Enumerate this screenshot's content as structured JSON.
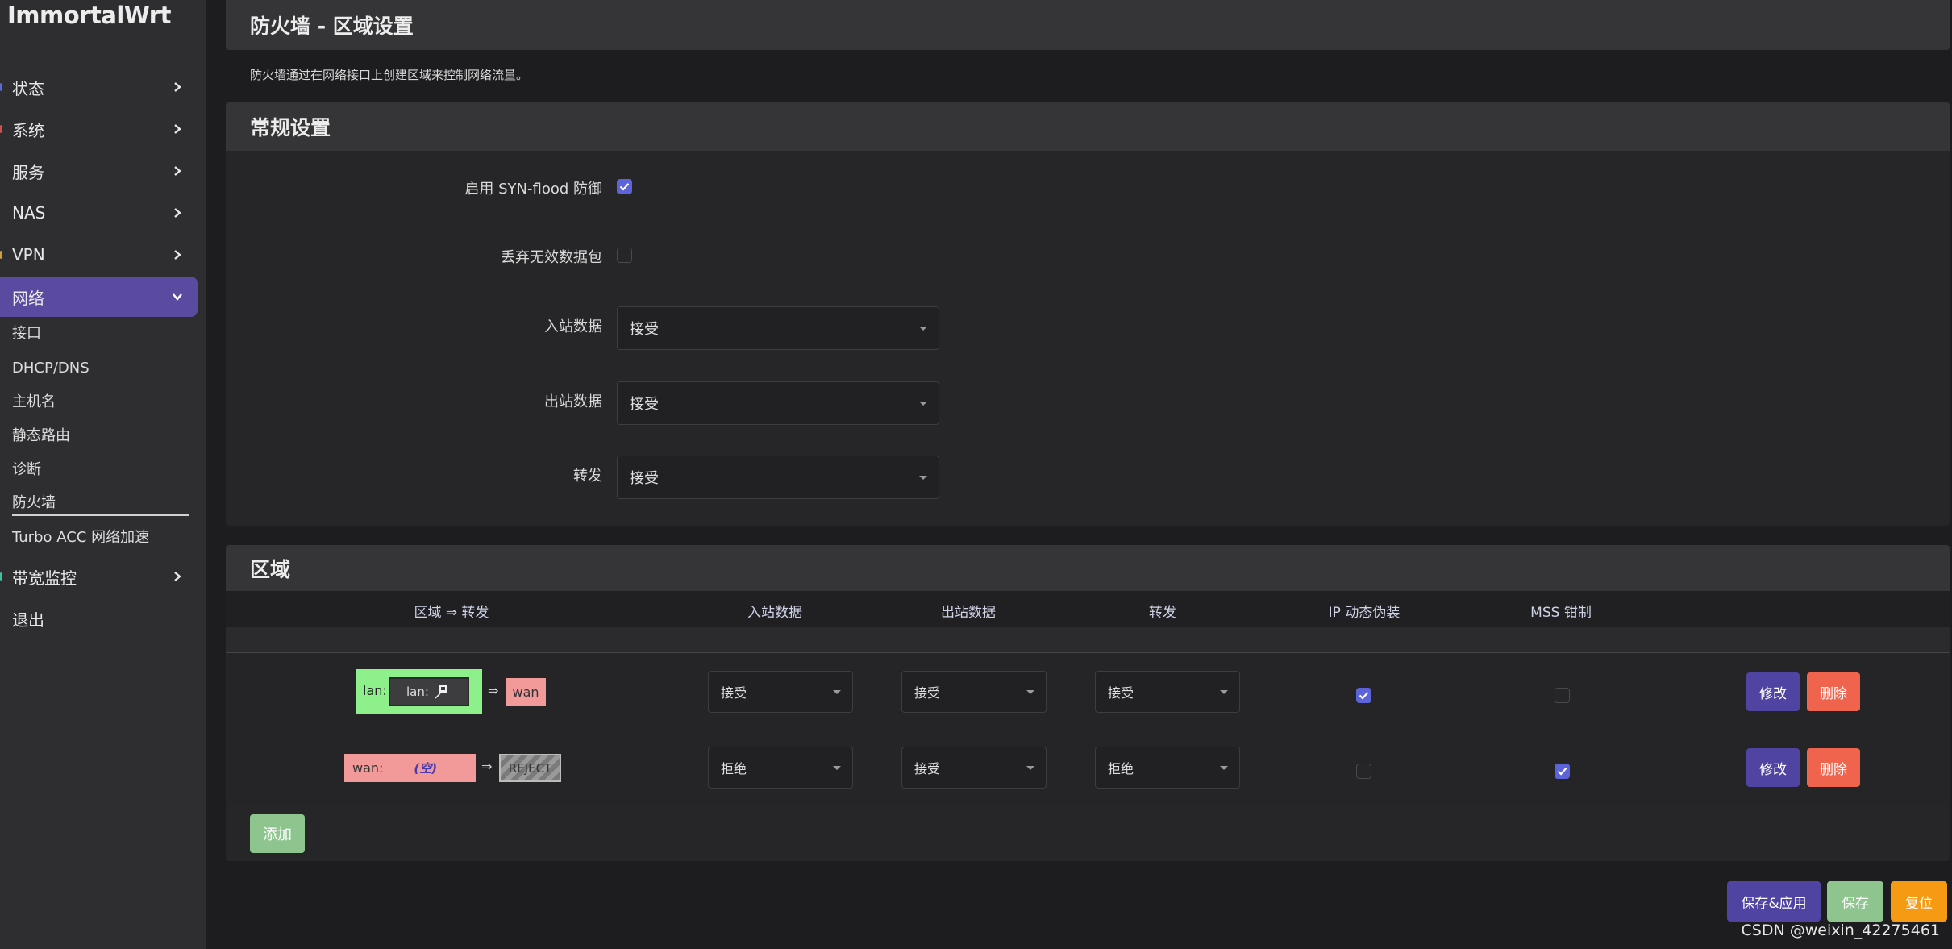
{
  "brand": "ImmortalWrt",
  "sidebar": {
    "items": [
      {
        "label": "状态"
      },
      {
        "label": "系统"
      },
      {
        "label": "服务"
      },
      {
        "label": "NAS"
      },
      {
        "label": "VPN"
      },
      {
        "label": "网络"
      }
    ],
    "sub_items": [
      "接口",
      "DHCP/DNS",
      "主机名",
      "静态路由",
      "诊断",
      "防火墙",
      "Turbo ACC 网络加速"
    ],
    "after_items": [
      {
        "label": "带宽监控"
      }
    ],
    "logout": "退出"
  },
  "page": {
    "title": "防火墙 - 区域设置",
    "description": "防火墙通过在网络接口上创建区域来控制网络流量。"
  },
  "general": {
    "title": "常规设置",
    "syn_flood_label": "启用 SYN-flood 防御",
    "syn_flood_checked": true,
    "drop_invalid_label": "丢弃无效数据包",
    "drop_invalid_checked": false,
    "input_label": "入站数据",
    "input_value": "接受",
    "output_label": "出站数据",
    "output_value": "接受",
    "forward_label": "转发",
    "forward_value": "接受"
  },
  "zones": {
    "title": "区域",
    "headers": {
      "zone": "区域 ⇒ 转发",
      "input": "入站数据",
      "output": "出站数据",
      "forward": "转发",
      "masq": "IP 动态伪装",
      "mss": "MSS 钳制"
    },
    "rows": [
      {
        "zone_label": "lan:",
        "inner_label": "lan:",
        "arrow": "⇒",
        "target": "wan",
        "input": "接受",
        "output": "接受",
        "forward": "接受",
        "masq": true,
        "mss": false,
        "edit": "修改",
        "delete": "删除"
      },
      {
        "zone_label": "wan:",
        "empty_label": "(空)",
        "arrow": "⇒",
        "target": "REJECT",
        "input": "拒绝",
        "output": "接受",
        "forward": "拒绝",
        "masq": false,
        "mss": true,
        "edit": "修改",
        "delete": "删除"
      }
    ],
    "add_label": "添加"
  },
  "footer": {
    "save_apply": "保存&应用",
    "save": "保存",
    "reset": "复位",
    "watermark": "CSDN @weixin_42275461"
  },
  "colors": {
    "accent": "#5a4aa0",
    "checkbox": "#5d63d8",
    "edit_button": "#4f44a2",
    "delete_button": "#f0644d",
    "add_button": "#8ec58f",
    "reset_button": "#f59a12",
    "zone_lan": "#8ef08a",
    "zone_wan": "#f29a9a"
  }
}
